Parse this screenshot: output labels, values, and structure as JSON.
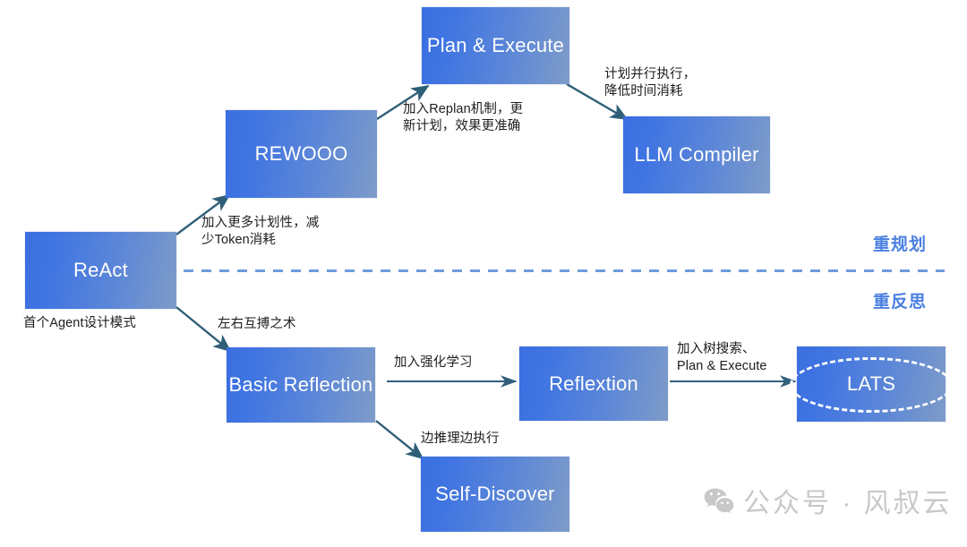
{
  "diagram": {
    "title": "Agent Design Patterns Evolution",
    "colors": {
      "node_gradient_start": "#3b6fe0",
      "node_gradient_end": "#7e9cc9",
      "arrow": "#2f5f78",
      "divider": "#6f9bdc",
      "side_label": "#4a7fe0",
      "node_text": "#ffffff",
      "edge_label_text": "#1d1d1f",
      "watermark": "#c8c8c8"
    },
    "nodes": [
      {
        "id": "react",
        "label": "ReAct"
      },
      {
        "id": "rewooo",
        "label": "REWOOO"
      },
      {
        "id": "plan-execute",
        "label": "Plan & Execute"
      },
      {
        "id": "llm-compiler",
        "label": "LLM Compiler"
      },
      {
        "id": "basic-reflection",
        "label": "Basic Reflection"
      },
      {
        "id": "reflextion",
        "label": "Reflextion"
      },
      {
        "id": "lats",
        "label": "LATS"
      },
      {
        "id": "self-discover",
        "label": "Self-Discover"
      }
    ],
    "edge_labels": [
      {
        "id": "react-to-rewooo",
        "text": "加入更多计划性，减\n少Token消耗"
      },
      {
        "id": "rewooo-to-plan-execute",
        "text": "加入Replan机制，更\n新计划，效果更准确"
      },
      {
        "id": "plan-execute-to-compiler",
        "text": "计划并行执行，\n降低时间消耗"
      },
      {
        "id": "react-caption",
        "text": "首个Agent设计模式"
      },
      {
        "id": "react-to-basic-reflection",
        "text": "左右互搏之术"
      },
      {
        "id": "basic-to-reflextion",
        "text": "加入强化学习"
      },
      {
        "id": "reflextion-to-lats",
        "text": "加入树搜索、\nPlan & Execute"
      },
      {
        "id": "basic-to-self-discover",
        "text": "边推理边执行"
      }
    ],
    "side_labels": [
      {
        "id": "replanning",
        "text": "重规划"
      },
      {
        "id": "reflection",
        "text": "重反思"
      }
    ],
    "watermark": {
      "icon": "wechat-icon",
      "text": "公众号 · 风叔云"
    }
  }
}
